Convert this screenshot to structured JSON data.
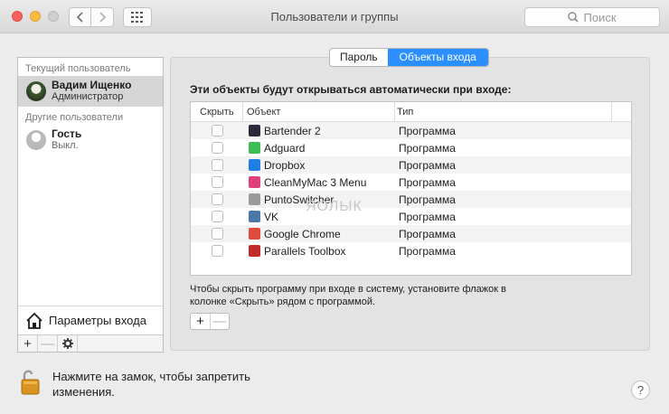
{
  "window": {
    "title": "Пользователи и группы",
    "search_placeholder": "Поиск"
  },
  "sidebar": {
    "current_user_header": "Текущий пользователь",
    "current_user": {
      "name": "Вадим Ищенко",
      "role": "Администратор"
    },
    "other_users_header": "Другие пользователи",
    "other_users": [
      {
        "name": "Гость",
        "role": "Выкл."
      }
    ],
    "login_options_label": "Параметры входа",
    "tool_add": "+",
    "tool_remove": "—"
  },
  "tabs": [
    {
      "label": "Пароль",
      "active": false
    },
    {
      "label": "Объекты входа",
      "active": true
    }
  ],
  "login_items": {
    "caption": "Эти объекты будут открываться автоматически при входе:",
    "columns": {
      "hide": "Скрыть",
      "object": "Объект",
      "type": "Тип"
    },
    "rows": [
      {
        "name": "Bartender 2",
        "type": "Программа",
        "icon": "bartender-icon",
        "color": "#2a2a3a"
      },
      {
        "name": "Adguard",
        "type": "Программа",
        "icon": "adguard-icon",
        "color": "#3dbb55"
      },
      {
        "name": "Dropbox",
        "type": "Программа",
        "icon": "dropbox-icon",
        "color": "#1f7fe5"
      },
      {
        "name": "CleanMyMac 3 Menu",
        "type": "Программа",
        "icon": "cleanmymac-icon",
        "color": "#e0407a"
      },
      {
        "name": "PuntoSwitcher",
        "type": "Программа",
        "icon": "puntoswitcher-icon",
        "color": "#9a9a9a"
      },
      {
        "name": "VK",
        "type": "Программа",
        "icon": "vk-icon",
        "color": "#4a76a8"
      },
      {
        "name": "Google Chrome",
        "type": "Программа",
        "icon": "chrome-icon",
        "color": "#e04a3a"
      },
      {
        "name": "Parallels Toolbox",
        "type": "Программа",
        "icon": "parallels-icon",
        "color": "#c22a2a"
      }
    ],
    "hint": "Чтобы скрыть программу при входе в систему, установите флажок в колонке «Скрыть» рядом с программой.",
    "add": "+",
    "remove": "—"
  },
  "footer": {
    "lock_text": "Нажмите на замок, чтобы запретить изменения.",
    "help": "?"
  },
  "watermark": "ЯОЛЫК"
}
